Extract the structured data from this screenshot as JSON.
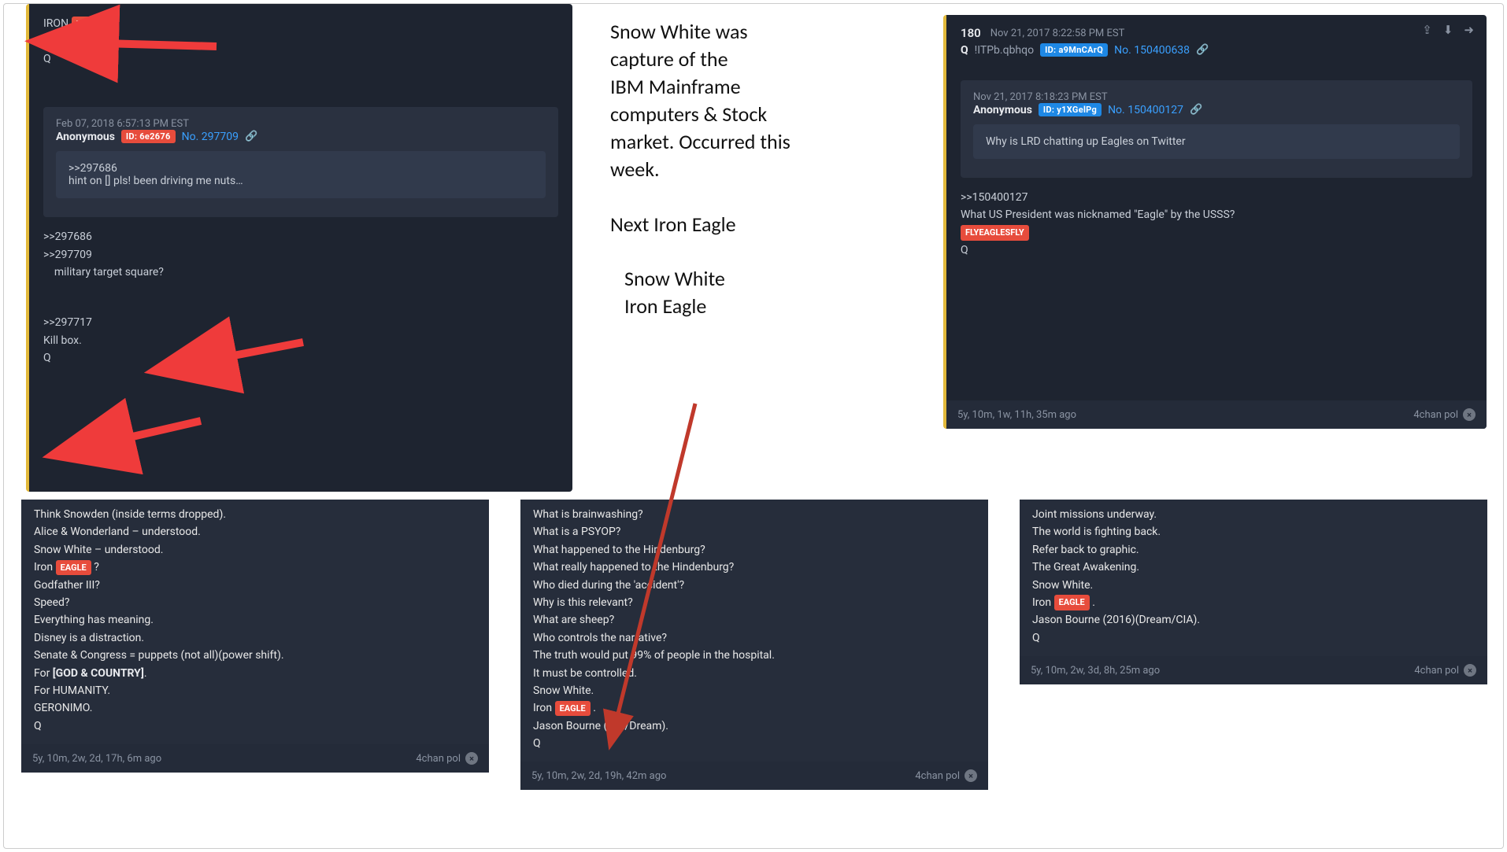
{
  "annotation": {
    "l1": "Snow White was",
    "l2": "capture of the",
    "l3": "IBM Mainframe",
    "l4": "computers & Stock",
    "l5": "market. Occurred this",
    "l6": "week.",
    "gap1": "",
    "l7": "Next Iron Eagle",
    "gap2": "",
    "l8": "Snow White",
    "l9": "Iron Eagle"
  },
  "topLeft": {
    "iron_prefix": "IRON ",
    "iron_tag": "EAGLE",
    "iron_suffix": " .",
    "bracket": "[]",
    "sig": "Q",
    "quote": {
      "ts": "Feb 07, 2018 6:57:13 PM EST",
      "author": "Anonymous",
      "id_label": "ID: 6e2676",
      "no_prefix": "No. ",
      "no": "297709",
      "ref": ">>297686",
      "body": "hint on []  pls! been driving me nuts…"
    },
    "refs": {
      "r1": ">>297686",
      "r2": ">>297709",
      "r3_indent": "    military target square?"
    },
    "reply": {
      "ref": ">>297717",
      "line": "Kill box.",
      "sig": "Q"
    }
  },
  "colA": {
    "lines": [
      "Think Snowden (inside terms dropped).",
      "Alice & Wonderland – understood.",
      "Snow White – understood."
    ],
    "iron_prefix": "Iron ",
    "iron_tag": "EAGLE",
    "iron_suffix": " ?",
    "lines2": [
      "Godfather III?",
      "Speed?",
      "Everything has meaning.",
      "Disney is a distraction.",
      "Senate & Congress = puppets (not all)(power shift)."
    ],
    "for_gc_pre": "For ",
    "for_gc_bold": "[GOD & COUNTRY]",
    "for_gc_post": ".",
    "lines3": [
      "For HUMANITY.",
      "GERONIMO.",
      "Q"
    ],
    "footer": {
      "age": "5y, 10m, 2w, 2d, 17h, 6m ago",
      "src": "4chan pol"
    }
  },
  "colB": {
    "lines": [
      "What is brainwashing?",
      "What is a PSYOP?",
      "What happened to the Hindenburg?",
      "What really happened to the Hindenburg?",
      "Who died during the 'accident'?",
      "Why is this relevant?",
      "What are sheep?",
      "Who controls the narrative?",
      "The truth would put 99% of people in the hospital.",
      "It must be controlled.",
      "Snow White."
    ],
    "iron_prefix": "Iron ",
    "iron_tag": "EAGLE",
    "iron_suffix": " .",
    "lines2": [
      "Jason Bourne (CIA/Dream).",
      "Q"
    ],
    "footer": {
      "age": "5y, 10m, 2w, 2d, 19h, 42m ago",
      "src": "4chan pol"
    }
  },
  "colC": {
    "lines": [
      "Joint missions underway.",
      "The world is fighting back.",
      "Refer back to graphic.",
      "The Great Awakening.",
      "Snow White."
    ],
    "iron_prefix": "Iron ",
    "iron_tag": "EAGLE",
    "iron_suffix": " .",
    "lines2": [
      "Jason Bourne (2016)(Dream/CIA).",
      "Q"
    ],
    "footer": {
      "age": "5y, 10m, 2w, 3d, 8h, 25m ago",
      "src": "4chan pol"
    }
  },
  "rightCard": {
    "num": "180",
    "ts": "Nov 21, 2017 8:22:58 PM EST",
    "qmark": "Q",
    "trip": "!ITPb.qbhqo",
    "id_label": "ID: a9MnCArQ",
    "no_prefix": "No. ",
    "no": "150400638",
    "quote": {
      "ts": "Nov 21, 2017 8:18:23 PM EST",
      "author": "Anonymous",
      "id_label": "ID: y1XGelPg",
      "no_prefix": "No. ",
      "no": "150400127",
      "body": "Why is LRD chatting up Eagles on Twitter"
    },
    "reply": {
      "ref": ">>150400127",
      "line": "What US President was nicknamed \"Eagle\" by the USSS?",
      "tag": "FLYEAGLESFLY",
      "sig": "Q"
    },
    "footer": {
      "age": "5y, 10m, 1w, 11h, 35m ago",
      "src": "4chan pol"
    }
  },
  "icons": {
    "share": "share-icon",
    "download": "download-icon",
    "goto": "goto-icon",
    "link": "link-icon",
    "close": "×"
  }
}
